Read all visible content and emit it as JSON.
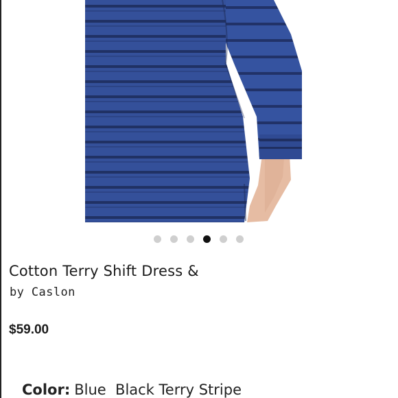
{
  "product": {
    "image_alt": "Blue and black striped terry dress worn by model",
    "carousel": {
      "total": 6,
      "active_index": 3
    },
    "title": "Cotton Terry Shift Dress &",
    "brand": "by Caslon",
    "price": "$59.00",
    "color": {
      "label": "Color:",
      "value": "Blue  Black Terry Stripe"
    }
  },
  "colors": {
    "fabric_blue": "#2f4a93",
    "stripe_navy": "#1d2c5c",
    "skin": "#e8bfa6",
    "dot_active": "#111111",
    "dot_inactive": "#cfcfcf"
  }
}
